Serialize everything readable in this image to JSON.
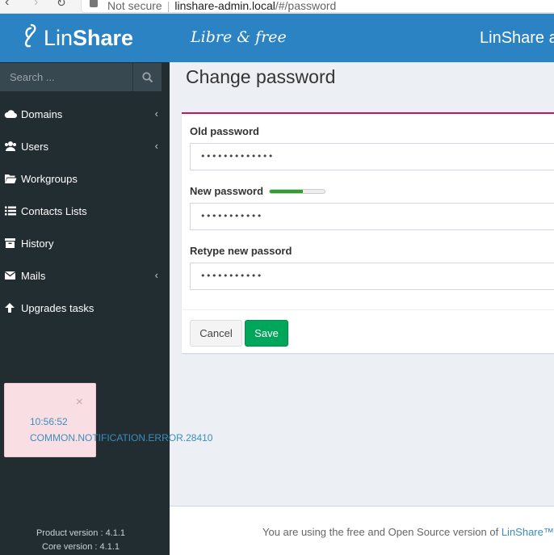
{
  "browser": {
    "security_label": "Not secure",
    "host": "linshare-admin.local",
    "path": "/#/password"
  },
  "header": {
    "logo_text_light": "Lin",
    "logo_text_bold": "Share",
    "tagline": "Libre & free",
    "title": "LinShare a"
  },
  "sidebar": {
    "search_placeholder": "Search ...",
    "items": [
      {
        "label": "Domains",
        "icon": "cloud-icon",
        "has_arrow": true
      },
      {
        "label": "Users",
        "icon": "users-icon",
        "has_arrow": true
      },
      {
        "label": "Workgroups",
        "icon": "folder-open-icon",
        "has_arrow": false
      },
      {
        "label": "Contacts Lists",
        "icon": "list-icon",
        "has_arrow": false
      },
      {
        "label": "History",
        "icon": "archive-icon",
        "has_arrow": false
      },
      {
        "label": "Mails",
        "icon": "envelope-icon",
        "has_arrow": true
      },
      {
        "label": "Upgrades tasks",
        "icon": "arrow-up-icon",
        "has_arrow": false
      }
    ],
    "product_version": "Product version : 4.1.1",
    "core_version": "Core version : 4.1.1"
  },
  "page": {
    "title": "Change password"
  },
  "form": {
    "old_label": "Old password",
    "old_value": "•••••••••••••",
    "new_label": "New password",
    "new_value": "•••••••••••",
    "new_strength": 0.6,
    "retype_label": "Retype new passord",
    "retype_value": "•••••••••••",
    "cancel_label": "Cancel",
    "save_label": "Save"
  },
  "notification": {
    "close_glyph": "×",
    "time": "10:56:52",
    "message": "COMMON.NOTIFICATION.ERROR.28410"
  },
  "footer": {
    "text": "You are using the free and Open Source version of ",
    "link": "LinShare™,"
  },
  "colors": {
    "header": "#2b83c4",
    "sidebar": "#222d32",
    "save": "#00a65a",
    "box_accent": "#c2185b",
    "notification_bg": "#f9dfe3"
  }
}
